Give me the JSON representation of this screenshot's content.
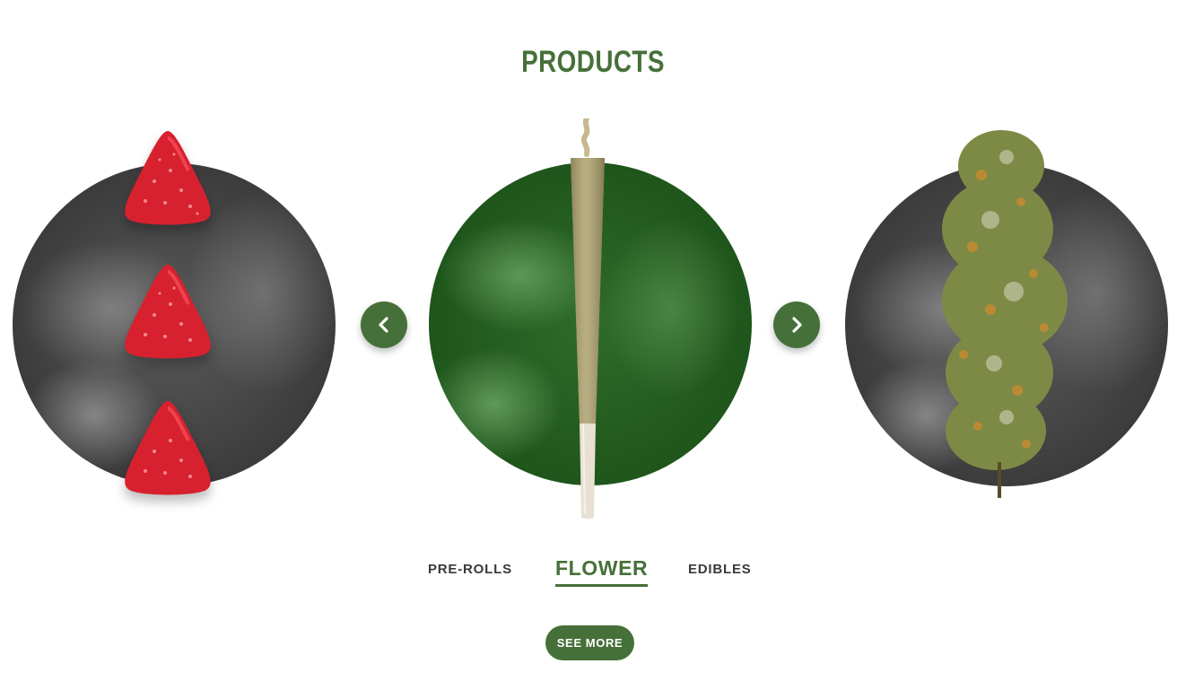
{
  "section": {
    "title": "PRODUCTS"
  },
  "carousel": {
    "prev_icon": "chevron-left-icon",
    "next_icon": "chevron-right-icon",
    "items": [
      {
        "category": "Edibles",
        "image": "strawberry-gummies",
        "style": "grayscale-smoke"
      },
      {
        "category": "Pre-Rolls",
        "image": "pre-roll-joint",
        "style": "green-smoke"
      },
      {
        "category": "Flower",
        "image": "flower-bud",
        "style": "grayscale-smoke"
      }
    ]
  },
  "tabs": {
    "prerolls": "PRE-ROLLS",
    "flower": "FLOWER",
    "edibles": "EDIBLES",
    "active": "flower"
  },
  "cta": {
    "see_more": "SEE MORE"
  },
  "colors": {
    "brand_green": "#467039",
    "gummy_red": "#d8212f",
    "text_dark": "#3a3a3a"
  }
}
